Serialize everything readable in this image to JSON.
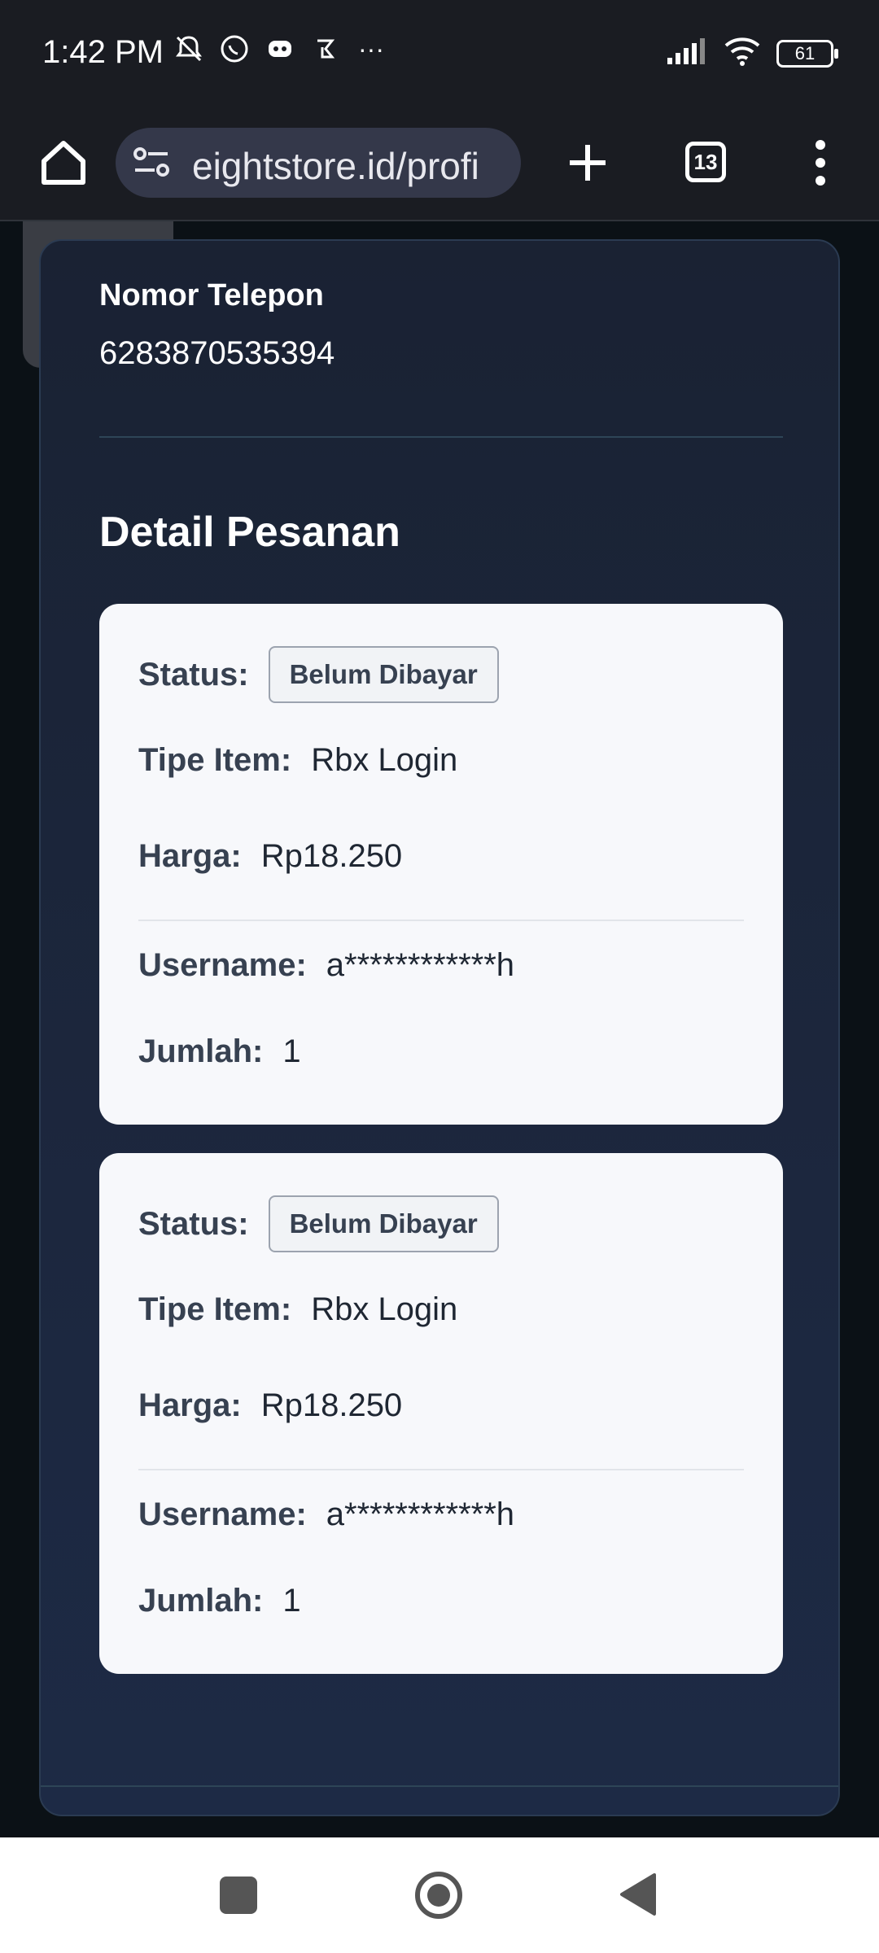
{
  "status_bar": {
    "time": "1:42 PM",
    "notification_icons": [
      "bell-off-icon",
      "whatsapp-icon",
      "discord-icon",
      "app-icon",
      "more-dots"
    ],
    "more": "···",
    "battery": "61"
  },
  "browser": {
    "url": "eightstore.id/profi",
    "tab_count": "13"
  },
  "modal": {
    "phone_label": "Nomor Telepon",
    "phone_value": "6283870535394",
    "section_title": "Detail Pesanan",
    "orders": [
      {
        "status_label": "Status:",
        "status_value": "Belum Dibayar",
        "item_type_label": "Tipe Item:",
        "item_type_value": "Rbx Login",
        "price_label": "Harga:",
        "price_value": "Rp18.250",
        "username_label": "Username:",
        "username_value": "a************h",
        "quantity_label": "Jumlah:",
        "quantity_value": "1"
      },
      {
        "status_label": "Status:",
        "status_value": "Belum Dibayar",
        "item_type_label": "Tipe Item:",
        "item_type_value": "Rbx Login",
        "price_label": "Harga:",
        "price_value": "Rp18.250",
        "username_label": "Username:",
        "username_value": "a************h",
        "quantity_label": "Jumlah:",
        "quantity_value": "1"
      }
    ]
  },
  "colors": {
    "modal_bg": "#1a2233",
    "card_bg": "#f7f8fb",
    "status_bar_bg": "#1a1c22"
  }
}
